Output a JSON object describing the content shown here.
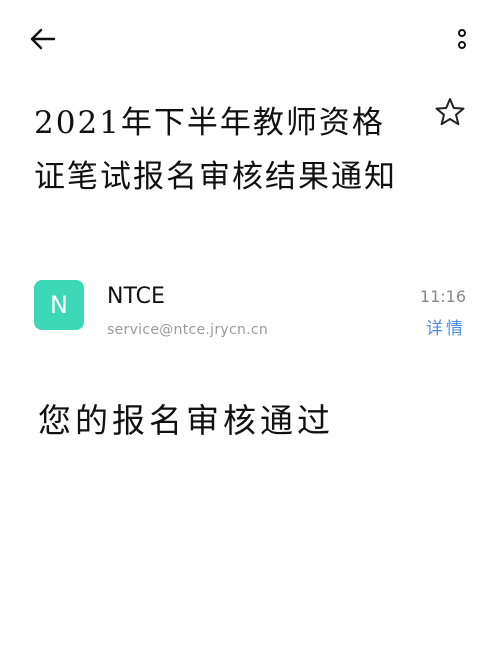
{
  "header": {
    "back_icon": "arrow-left-icon",
    "more_icon": "more-vertical-icon"
  },
  "email": {
    "subject": "2021年下半年教师资格证笔试报名审核结果通知",
    "star_icon": "star-outline-icon",
    "sender": {
      "avatar_letter": "N",
      "avatar_color": "#3dd9b6",
      "name": "NTCE",
      "email": "service@ntce.jrycn.cn"
    },
    "time": "11:16",
    "details_label": "详情",
    "details_color": "#4a8ee8",
    "body": "您的报名审核通过"
  }
}
